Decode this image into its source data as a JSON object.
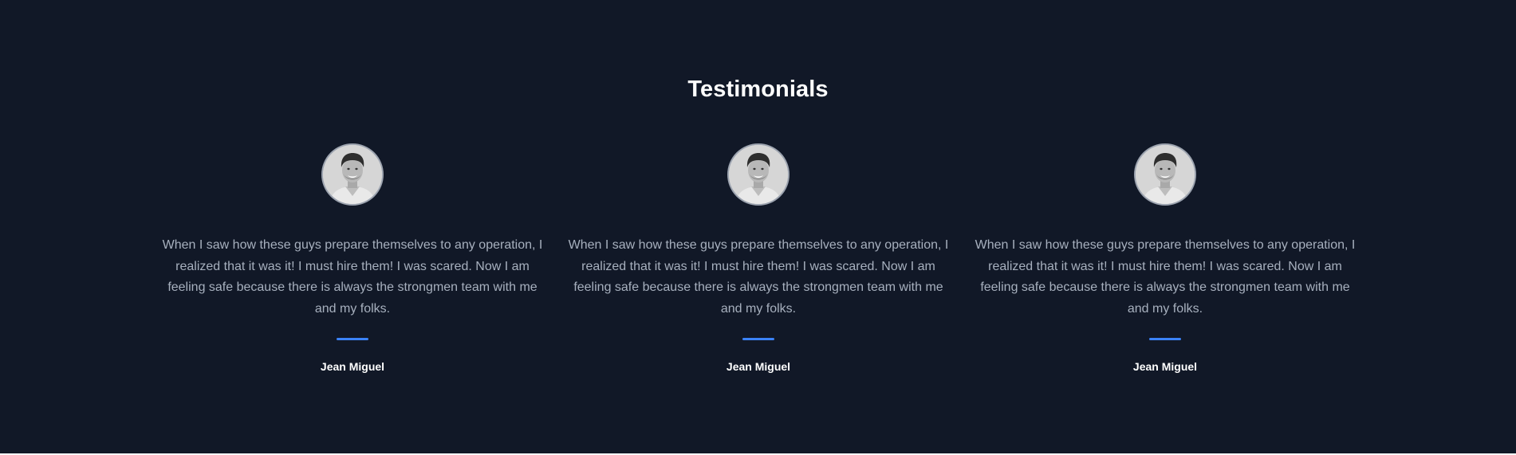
{
  "section": {
    "title": "Testimonials",
    "accent_color": "#3b82f6",
    "background_color": "#111827"
  },
  "testimonials": [
    {
      "avatar_icon": "person-photo-avatar",
      "quote": "When I saw how these guys prepare themselves to any operation, I realized that it was it! I must hire them! I was scared. Now I am feeling safe because there is always the strongmen team with me and my folks.",
      "author": "Jean Miguel"
    },
    {
      "avatar_icon": "person-photo-avatar",
      "quote": "When I saw how these guys prepare themselves to any operation, I realized that it was it! I must hire them! I was scared. Now I am feeling safe because there is always the strongmen team with me and my folks.",
      "author": "Jean Miguel"
    },
    {
      "avatar_icon": "person-photo-avatar",
      "quote": "When I saw how these guys prepare themselves to any operation, I realized that it was it! I must hire them! I was scared. Now I am feeling safe because there is always the strongmen team with me and my folks.",
      "author": "Jean Miguel"
    }
  ]
}
